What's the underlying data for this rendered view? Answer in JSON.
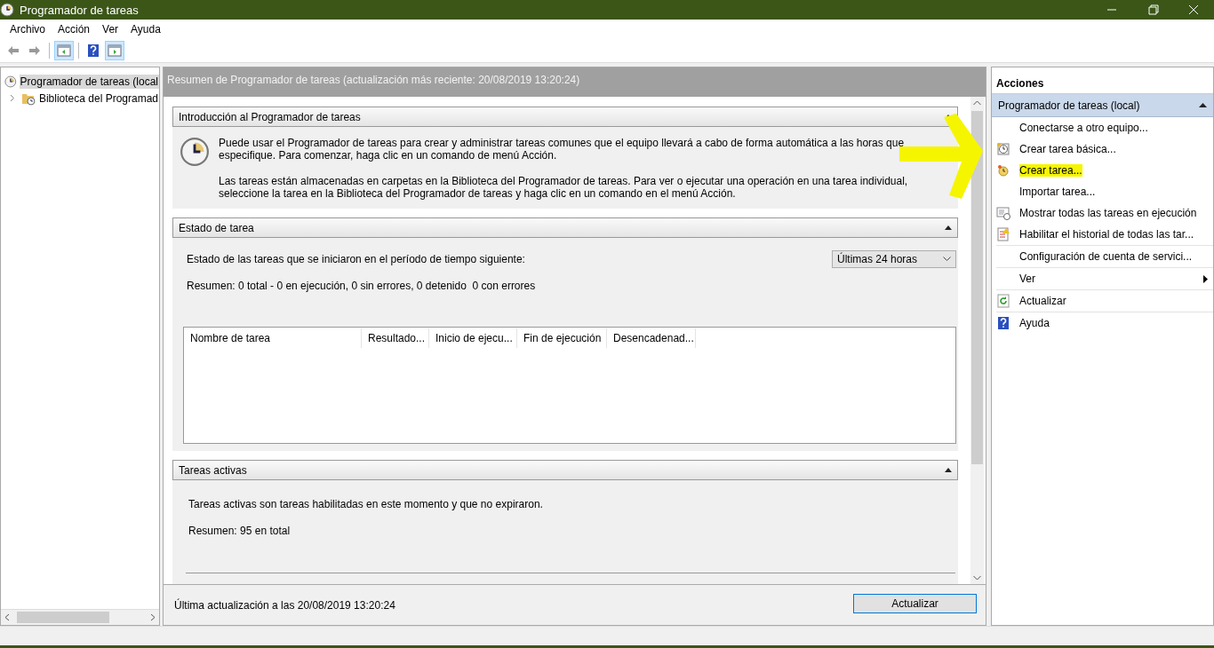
{
  "window": {
    "title": "Programador de tareas"
  },
  "menu": [
    {
      "label": "Archivo"
    },
    {
      "label": "Acción"
    },
    {
      "label": "Ver"
    },
    {
      "label": "Ayuda"
    }
  ],
  "toolbar": [
    {
      "kind": "back",
      "on": false
    },
    {
      "kind": "forward",
      "on": false
    },
    {
      "kind": "tree-pane",
      "on": true
    },
    {
      "kind": "help",
      "on": false
    },
    {
      "kind": "action-pane",
      "on": true
    }
  ],
  "tree": [
    {
      "label": "Programador de tareas (local",
      "selected": true,
      "children": [
        {
          "label": "Biblioteca del Programad",
          "selected": false,
          "expanded": false
        }
      ]
    }
  ],
  "summary": {
    "header": "Resumen de Programador de tareas (actualización más reciente: 20/08/2019 13:20:24)",
    "sections": [
      {
        "kind": "intro",
        "title": "Introducción al Programador de tareas",
        "expanded": true,
        "paragraphs": [
          "Puede usar el Programador de tareas para crear y administrar tareas comunes que el equipo llevará a cabo de forma automática a las horas que especifique. Para comenzar, haga clic en un comando de menú Acción.",
          "Las tareas están almacenadas en carpetas en la Biblioteca del Programador de tareas. Para ver o ejecutar una operación en una tarea individual, seleccione la tarea en la Biblioteca del Programador de tareas y haga clic en un comando en el menú Acción."
        ]
      },
      {
        "kind": "status",
        "title": "Estado de tarea",
        "expanded": true,
        "prompt": "Estado de las tareas que se iniciaron en el período de tiempo siguiente:",
        "period": "Últimas 24 horas",
        "summary": "Resumen: 0 total - 0 en ejecución, 0 sin errores, 0 detenido  0 con errores",
        "columns": [
          "Nombre de tarea",
          "Resultado...",
          "Inicio de ejecu...",
          "Fin de ejecución",
          "Desencadenad..."
        ]
      },
      {
        "kind": "active",
        "title": "Tareas activas",
        "expanded": true,
        "text": "Tareas activas son tareas habilitadas en este momento y que no expiraron.",
        "summary": "Resumen: 95 en total"
      }
    ],
    "footer": "Última actualización a las 20/08/2019 13:20:24",
    "refresh_button": "Actualizar"
  },
  "actions": {
    "title": "Acciones",
    "group": {
      "label": "Programador de tareas (local)",
      "expanded": true
    },
    "items": [
      {
        "label": "Conectarse a otro equipo...",
        "kind": "none",
        "highlighted": false
      },
      {
        "label": "Crear tarea básica...",
        "kind": "basic-task",
        "highlighted": false
      },
      {
        "label": "Crear tarea...",
        "kind": "new-task",
        "highlighted": true
      },
      {
        "label": "Importar tarea...",
        "kind": "none",
        "highlighted": false
      },
      {
        "label": "Mostrar todas las tareas en ejecución",
        "kind": "running",
        "highlighted": false
      },
      {
        "label": "Habilitar el historial de todas las tar...",
        "kind": "history",
        "highlighted": false
      },
      {
        "kind": "separator"
      },
      {
        "label": "Configuración de cuenta de servici...",
        "kind": "none",
        "highlighted": false
      },
      {
        "kind": "separator"
      },
      {
        "label": "Ver",
        "kind": "none",
        "highlighted": false,
        "submenu": true
      },
      {
        "kind": "separator"
      },
      {
        "label": "Actualizar",
        "kind": "refresh",
        "highlighted": false
      },
      {
        "kind": "separator"
      },
      {
        "label": "Ayuda",
        "kind": "help",
        "highlighted": false
      }
    ]
  },
  "annotations": [
    {
      "kind": "arrow",
      "color": "#f5f500"
    }
  ]
}
